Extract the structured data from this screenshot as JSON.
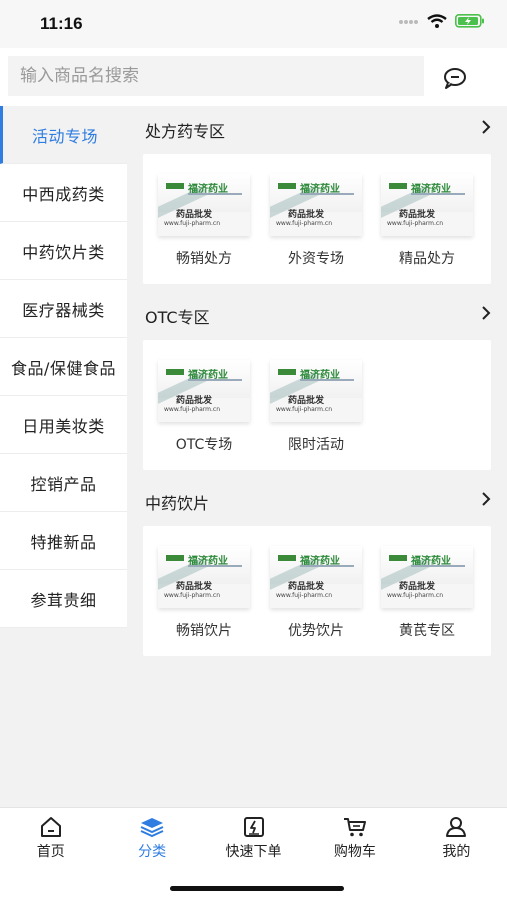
{
  "status": {
    "time": "11:16"
  },
  "search": {
    "placeholder": "输入商品名搜索"
  },
  "sidebar": {
    "items": [
      {
        "label": "活动专场"
      },
      {
        "label": "中西成药类"
      },
      {
        "label": "中药饮片类"
      },
      {
        "label": "医疗器械类"
      },
      {
        "label": "食品/保健食品"
      },
      {
        "label": "日用美妆类"
      },
      {
        "label": "控销产品"
      },
      {
        "label": "特推新品"
      },
      {
        "label": "参茸贵细"
      }
    ]
  },
  "thumb": {
    "brand": "福济药业",
    "caption": "药品批发",
    "url": "www.fuji-pharm.cn"
  },
  "sections": [
    {
      "title": "处方药专区",
      "items": [
        "畅销处方",
        "外资专场",
        "精品处方"
      ]
    },
    {
      "title": "OTC专区",
      "items": [
        "OTC专场",
        "限时活动"
      ]
    },
    {
      "title": "中药饮片",
      "items": [
        "畅销饮片",
        "优势饮片",
        "黄芪专区"
      ]
    }
  ],
  "tabbar": {
    "items": [
      {
        "label": "首页",
        "icon": "home-icon"
      },
      {
        "label": "分类",
        "icon": "layers-icon"
      },
      {
        "label": "快速下单",
        "icon": "quick-order-icon"
      },
      {
        "label": "购物车",
        "icon": "cart-icon"
      },
      {
        "label": "我的",
        "icon": "user-icon"
      }
    ]
  },
  "colors": {
    "accent": "#2f7de1"
  }
}
